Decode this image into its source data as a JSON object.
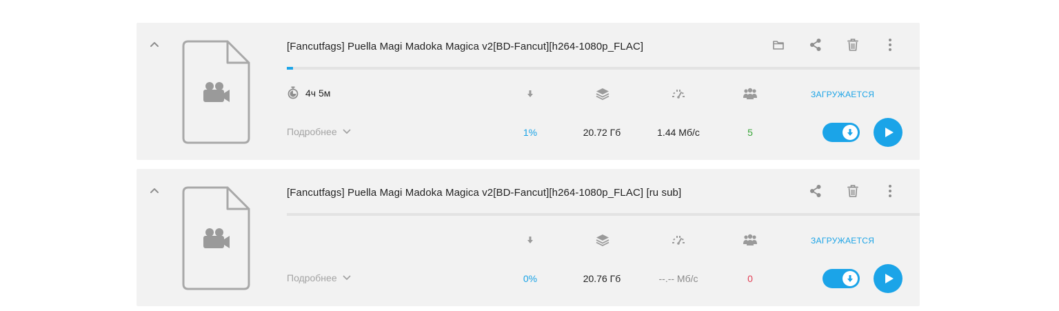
{
  "torrents": [
    {
      "title": "[Fancutfags] Puella Magi Madoka Magica v2[BD-Fancut][h264-1080p_FLAC]",
      "progress": 0.01,
      "eta": "4ч 5м",
      "status": "ЗАГРУЖАЕТСЯ",
      "details_label": "Подробнее",
      "percent": "1%",
      "size": "20.72 Гб",
      "speed": "1.44 Мб/с",
      "peers": "5",
      "has_folder": true,
      "icons": [
        "chevron-up",
        "video-file",
        "folder",
        "share",
        "trash",
        "more-vertical",
        "stopwatch",
        "arrow-down",
        "layers",
        "speedometer",
        "users",
        "chevron-down",
        "toggle-download",
        "play"
      ]
    },
    {
      "title": "[Fancutfags] Puella Magi Madoka Magica v2[BD-Fancut][h264-1080p_FLAC] [ru sub]",
      "progress": 0.0,
      "eta": "",
      "status": "ЗАГРУЖАЕТСЯ",
      "details_label": "Подробнее",
      "percent": "0%",
      "size": "20.76 Гб",
      "speed": "--.-- Мб/с",
      "peers": "0",
      "has_folder": false,
      "icons": [
        "chevron-up",
        "video-file",
        "share",
        "trash",
        "more-vertical",
        "arrow-down",
        "layers",
        "speedometer",
        "users",
        "chevron-down",
        "toggle-download",
        "play"
      ]
    }
  ],
  "colors": {
    "accent": "#1ba4e8",
    "card_bg": "#f2f2f2",
    "peers_ok": "#3aa63a",
    "peers_zero": "#e24057",
    "muted": "#a3a3a3"
  }
}
